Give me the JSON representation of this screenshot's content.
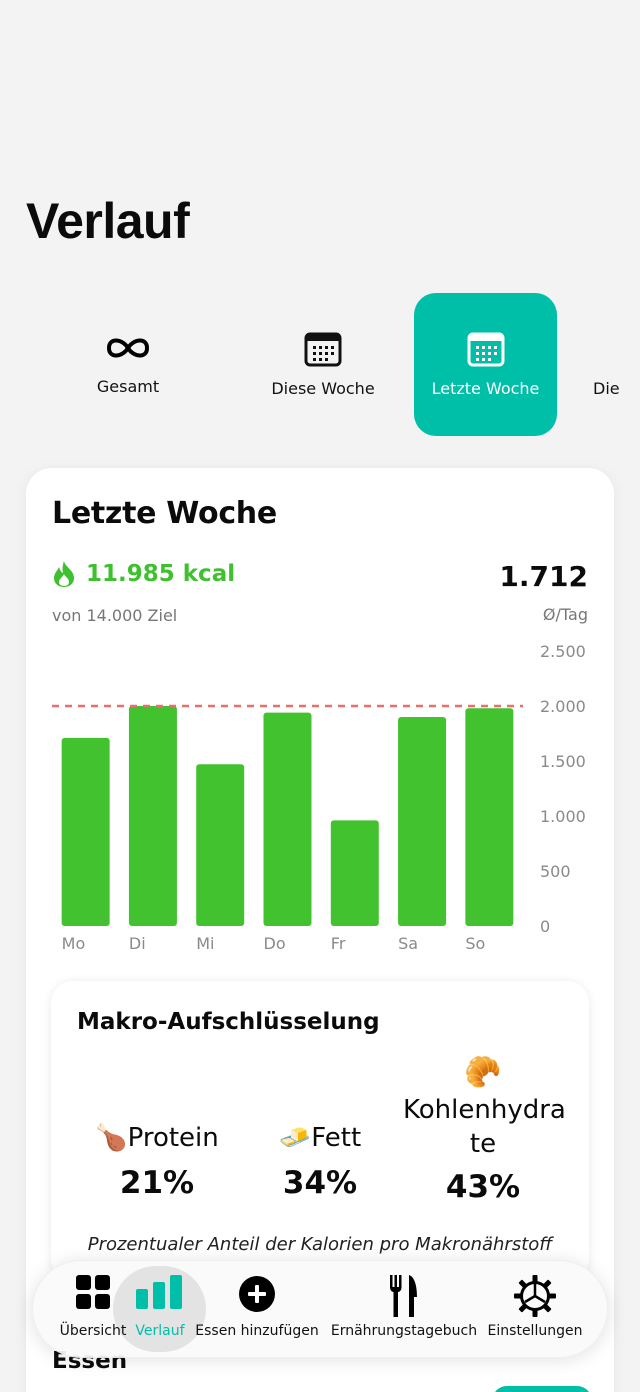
{
  "page": {
    "title": "Verlauf"
  },
  "tabs": [
    {
      "label": "Gesamt",
      "icon": "infinity-icon",
      "active": false
    },
    {
      "label": "Diese Woche",
      "icon": "calendar-icon",
      "active": false
    },
    {
      "label": "Letzte Woche",
      "icon": "calendar-icon",
      "active": true
    },
    {
      "label": "Die",
      "icon": "calendar-icon",
      "active": false
    }
  ],
  "card": {
    "title": "Letzte Woche",
    "total_kcal": "11.985 kcal",
    "goal": "von 14.000 Ziel",
    "avg_value": "1.712",
    "avg_label": "Ø/Tag"
  },
  "chart_data": {
    "type": "bar",
    "categories": [
      "Mo",
      "Di",
      "Mi",
      "Do",
      "Fr",
      "Sa",
      "So"
    ],
    "values": [
      1710,
      2000,
      1470,
      1940,
      960,
      1900,
      1980
    ],
    "yticks": [
      "0",
      "500",
      "1.000",
      "1.500",
      "2.000",
      "2.500"
    ],
    "ylim": [
      0,
      2500
    ],
    "goal_line": 2000,
    "bar_color": "#43c22f",
    "goal_line_color": "#e8706c"
  },
  "macro": {
    "title": "Makro-Aufschlüsselung",
    "items": [
      {
        "name": "Protein",
        "emoji": "🍗",
        "pct": "21%"
      },
      {
        "name": "Fett",
        "emoji": "🧈",
        "pct": "34%"
      },
      {
        "name": "Kohlenhydrate",
        "name_line1": "Kohlenhydra",
        "name_line2": "te",
        "emoji": "🥐",
        "pct": "43%"
      }
    ],
    "note": "Prozentualer Anteil der Kalorien pro Makronährstoff"
  },
  "section": {
    "title": "Essen"
  },
  "nav": {
    "items": [
      {
        "label": "Übersicht",
        "icon": "grid-icon"
      },
      {
        "label": "Verlauf",
        "icon": "bar-chart-icon",
        "active": true
      },
      {
        "label": "Essen hinzufügen",
        "icon": "plus-circle-icon"
      },
      {
        "label": "Ernährungstagebuch",
        "icon": "fork-knife-icon"
      },
      {
        "label": "Einstellungen",
        "icon": "gear-icon"
      }
    ]
  },
  "colors": {
    "accent": "#00bfa8",
    "kcal_green": "#3fc02f"
  }
}
